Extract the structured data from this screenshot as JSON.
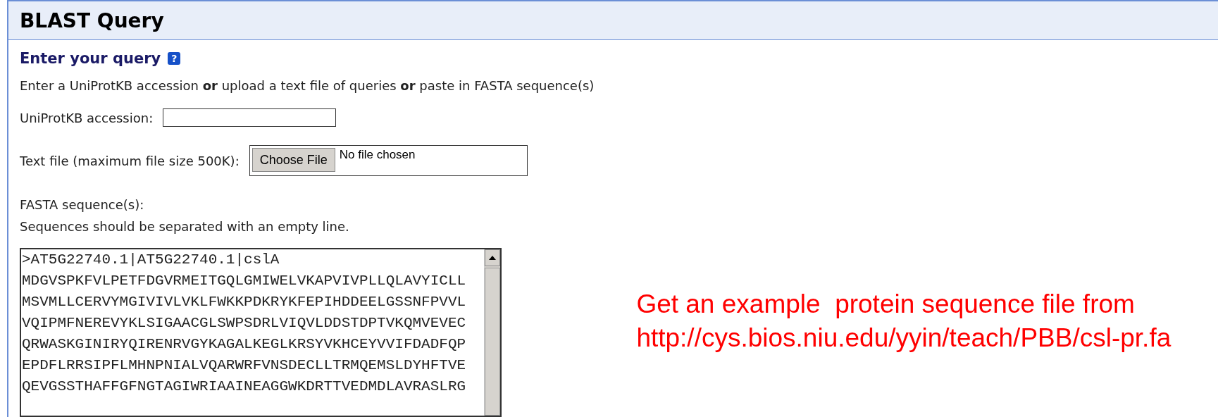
{
  "panel": {
    "title": "BLAST Query"
  },
  "section": {
    "heading": "Enter your query",
    "help_icon": "?"
  },
  "intro": "Enter a UniProtKB accession **or** upload a text file of queries **or** paste in FASTA sequence(s)",
  "accession": {
    "label": "UniProtKB accession:"
  },
  "text_file": {
    "label": "Text file (maximum file size 500K):",
    "button": "Choose File",
    "status": "No file chosen"
  },
  "fasta": {
    "label": "FASTA sequence(s):",
    "hint": "Sequences should be separated with an empty line.",
    "lines": [
      ">AT5G22740.1|AT5G22740.1|cslA",
      "MDGVSPKFVLPETFDGVRMEITGQLGMIWELVKAPVIVPLLQLAVYICLL",
      "MSVMLLCERVYMGIVIVLVKLFWKKPDKRYKFEPIHDDEELGSSNFPVVL",
      "VQIPMFNEREVYKLSIGAACGLSWPSDRLVIQVLDDSTDPTVKQMVEVEC",
      "QRWASKGINIRYQIRENRVGYKAGALKEGLKRSYVKHCEYVVIFDADFQP",
      "EPDFLRRSIPFLMHNPNIALVQARWRFVNSDECLLTRMQEMSLDYHFTVE",
      "QEVGSSTHAFFGFNGTAGIWRIAAINEAGGWKDRTTVEDMDLAVRASLRG"
    ]
  },
  "note": {
    "lines": [
      "Get an example  protein sequence file from",
      "http://cys.bios.niu.edu/yyin/teach/PBB/csl-pr.fa"
    ]
  }
}
